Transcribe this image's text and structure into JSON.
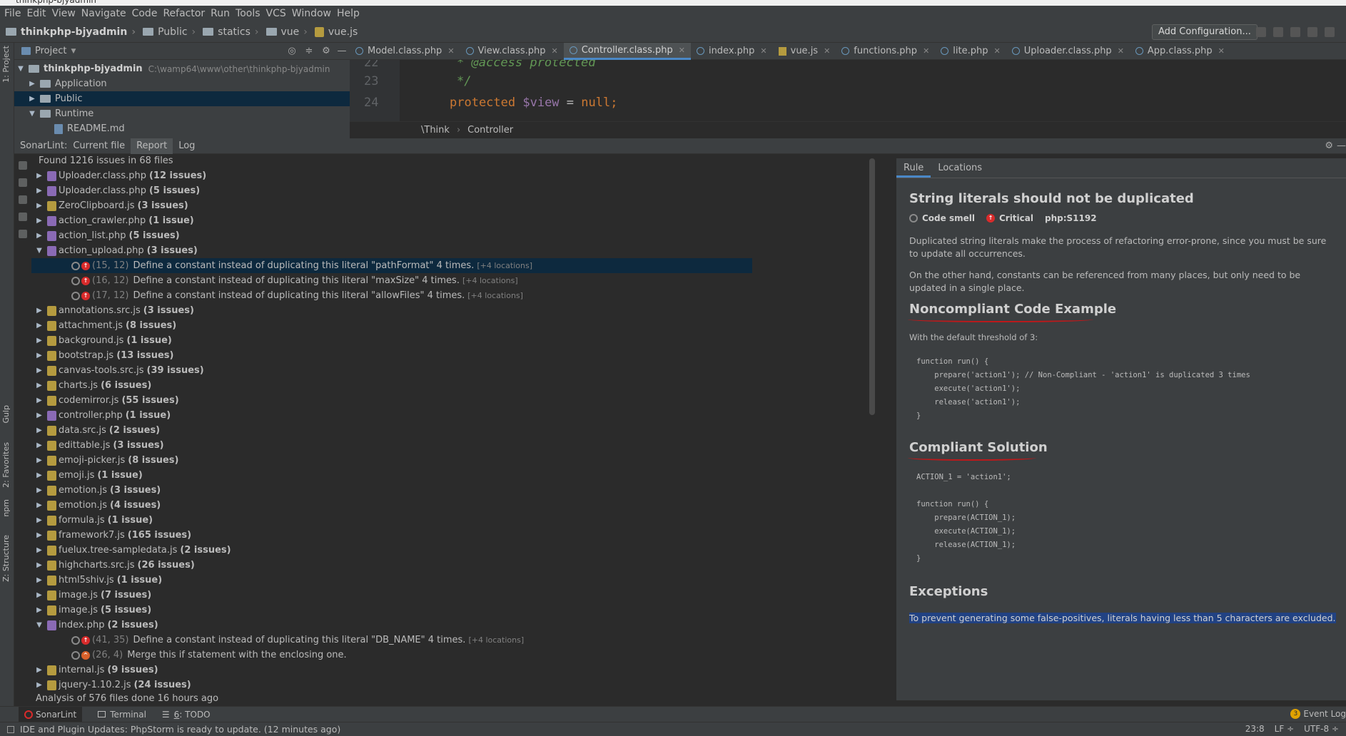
{
  "menu": [
    "File",
    "Edit",
    "View",
    "Navigate",
    "Code",
    "Refactor",
    "Run",
    "Tools",
    "VCS",
    "Window",
    "Help"
  ],
  "breadcrumbs": [
    "thinkphp-bjyadmin",
    "Public",
    "statics",
    "vue",
    "vue.js"
  ],
  "toolbar": {
    "add_configuration": "Add Configuration..."
  },
  "side_tabs": {
    "project": "1: Project",
    "gulp": "Gulp",
    "favorites": "2: Favorites",
    "npm": "npm",
    "structure": "Z: Structure"
  },
  "project_panel": {
    "title": "Project",
    "root": {
      "name": "thinkphp-bjyadmin",
      "path": "C:\\wamp64\\www\\other\\thinkphp-bjyadmin"
    },
    "items": [
      "Application",
      "Public",
      "Runtime",
      "README.md"
    ]
  },
  "editor": {
    "tabs": [
      "Model.class.php",
      "View.class.php",
      "Controller.class.php",
      "index.php",
      "vue.js",
      "functions.php",
      "lite.php",
      "Uploader.class.php",
      "App.class.php"
    ],
    "lines": [
      {
        "num": "22",
        "text": "* @access protected"
      },
      {
        "num": "23",
        "text": "*/"
      },
      {
        "num": "24",
        "kw": "protected ",
        "var": "$view",
        "rest": " = ",
        "kw2": "null",
        "end": ";"
      }
    ],
    "breadcrumb": [
      "\\Think",
      "Controller"
    ]
  },
  "sonarlint": {
    "label": "SonarLint:",
    "tabs": [
      "Current file",
      "Report",
      "Log"
    ],
    "summary": "Found 1216 issues in 68 files",
    "files": [
      {
        "name": "Uploader.class.php",
        "count": "(12 issues)",
        "type": "php"
      },
      {
        "name": "Uploader.class.php",
        "count": "(5 issues)",
        "type": "php"
      },
      {
        "name": "ZeroClipboard.js",
        "count": "(3 issues)",
        "type": "js"
      },
      {
        "name": "action_crawler.php",
        "count": "(1 issue)",
        "type": "php"
      },
      {
        "name": "action_list.php",
        "count": "(5 issues)",
        "type": "php"
      },
      {
        "name": "action_upload.php",
        "count": "(3 issues)",
        "type": "php"
      },
      {
        "name": "annotations.src.js",
        "count": "(3 issues)",
        "type": "js"
      },
      {
        "name": "attachment.js",
        "count": "(8 issues)",
        "type": "js"
      },
      {
        "name": "background.js",
        "count": "(1 issue)",
        "type": "js"
      },
      {
        "name": "bootstrap.js",
        "count": "(13 issues)",
        "type": "js"
      },
      {
        "name": "canvas-tools.src.js",
        "count": "(39 issues)",
        "type": "js"
      },
      {
        "name": "charts.js",
        "count": "(6 issues)",
        "type": "js"
      },
      {
        "name": "codemirror.js",
        "count": "(55 issues)",
        "type": "js"
      },
      {
        "name": "controller.php",
        "count": "(1 issue)",
        "type": "php"
      },
      {
        "name": "data.src.js",
        "count": "(2 issues)",
        "type": "js"
      },
      {
        "name": "edittable.js",
        "count": "(3 issues)",
        "type": "js"
      },
      {
        "name": "emoji-picker.js",
        "count": "(8 issues)",
        "type": "js"
      },
      {
        "name": "emoji.js",
        "count": "(1 issue)",
        "type": "js"
      },
      {
        "name": "emotion.js",
        "count": "(3 issues)",
        "type": "js"
      },
      {
        "name": "emotion.js",
        "count": "(4 issues)",
        "type": "js"
      },
      {
        "name": "formula.js",
        "count": "(1 issue)",
        "type": "js"
      },
      {
        "name": "framework7.js",
        "count": "(165 issues)",
        "type": "js"
      },
      {
        "name": "fuelux.tree-sampledata.js",
        "count": "(2 issues)",
        "type": "js"
      },
      {
        "name": "highcharts.src.js",
        "count": "(26 issues)",
        "type": "js"
      },
      {
        "name": "html5shiv.js",
        "count": "(1 issue)",
        "type": "js"
      },
      {
        "name": "image.js",
        "count": "(7 issues)",
        "type": "js"
      },
      {
        "name": "image.js",
        "count": "(5 issues)",
        "type": "js"
      },
      {
        "name": "index.php",
        "count": "(2 issues)",
        "type": "php"
      },
      {
        "name": "internal.js",
        "count": "(9 issues)",
        "type": "js"
      },
      {
        "name": "jquery-1.10.2.js",
        "count": "(24 issues)",
        "type": "js"
      }
    ],
    "upload_issues": [
      {
        "loc": "(15, 12)",
        "msg": "Define a constant instead of duplicating this literal \"pathFormat\" 4 times.",
        "more": "[+4 locations]"
      },
      {
        "loc": "(16, 12)",
        "msg": "Define a constant instead of duplicating this literal \"maxSize\" 4 times.",
        "more": "[+4 locations]"
      },
      {
        "loc": "(17, 12)",
        "msg": "Define a constant instead of duplicating this literal \"allowFiles\" 4 times.",
        "more": "[+4 locations]"
      }
    ],
    "index_issues": [
      {
        "loc": "(41, 35)",
        "msg": "Define a constant instead of duplicating this literal \"DB_NAME\" 4 times.",
        "more": "[+4 locations]"
      },
      {
        "loc": "(26, 4)",
        "msg": "Merge this if statement with the enclosing one.",
        "more": ""
      }
    ],
    "analysis": "Analysis of 576 files done 16 hours ago"
  },
  "rule": {
    "tabs": [
      "Rule",
      "Locations"
    ],
    "title": "String literals should not be duplicated",
    "type": "Code smell",
    "severity": "Critical",
    "key": "php:S1192",
    "p1": "Duplicated string literals make the process of refactoring error-prone, since you must be sure to update all occurrences.",
    "p2": "On the other hand, constants can be referenced from many places, but only need to be updated in a single place.",
    "h_noncompliant": "Noncompliant Code Example",
    "threshold": "With the default threshold of 3:",
    "code_noncompliant": "function run() {\n    prepare('action1'); // Non-Compliant - 'action1' is duplicated 3 times\n    execute('action1');\n    release('action1');\n}",
    "h_compliant": "Compliant Solution",
    "code_compliant": "ACTION_1 = 'action1';\n\nfunction run() {\n    prepare(ACTION_1);\n    execute(ACTION_1);\n    release(ACTION_1);\n}",
    "h_exceptions": "Exceptions",
    "exceptions": "To prevent generating some false-positives, literals having less than 5 characters are excluded."
  },
  "bottom_tabs": {
    "sonarlint": "SonarLint",
    "terminal": "Terminal",
    "todo_num": "6",
    "todo": ": TODO",
    "eventlog": "Event Log",
    "event_count": "3"
  },
  "status": {
    "message": "IDE and Plugin Updates: PhpStorm is ready to update. (12 minutes ago)",
    "position": "23:8",
    "line_sep": "LF ÷",
    "encoding": "UTF-8 ÷"
  }
}
